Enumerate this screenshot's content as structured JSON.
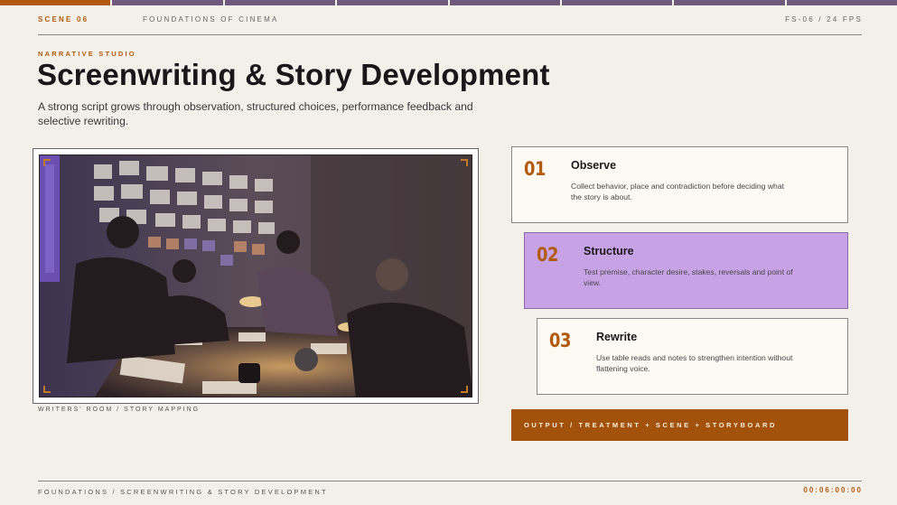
{
  "progress": {
    "total_segments": 8,
    "active_segment": 1
  },
  "header": {
    "scene": "SCENE 06",
    "course": "FOUNDATIONS OF CINEMA",
    "frame_info": "FS-06 / 24 FPS"
  },
  "eyebrow": "NARRATIVE STUDIO",
  "title": "Screenwriting & Story Development",
  "subtitle": "A strong script grows through observation, structured choices, performance feedback and selective rewriting.",
  "photo": {
    "caption": "WRITERS' ROOM / STORY MAPPING"
  },
  "steps": [
    {
      "number": "01",
      "title": "Observe",
      "description": "Collect behavior, place and contradiction before deciding what the story is about."
    },
    {
      "number": "02",
      "title": "Structure",
      "description": "Test premise, character desire, stakes, reversals and point of view."
    },
    {
      "number": "03",
      "title": "Rewrite",
      "description": "Use table reads and notes to strengthen intention without flattening voice."
    }
  ],
  "output_bar": "OUTPUT / TREATMENT + SCENE + STORYBOARD",
  "footer": {
    "path": "FOUNDATIONS / SCREENWRITING & STORY DEVELOPMENT",
    "timecode": "00:06:00:00"
  },
  "colors": {
    "accent": "#b25a0c",
    "highlight_step": "#c7a3e6",
    "progress_inactive": "#6f5a7c",
    "background": "#f3efe9"
  }
}
